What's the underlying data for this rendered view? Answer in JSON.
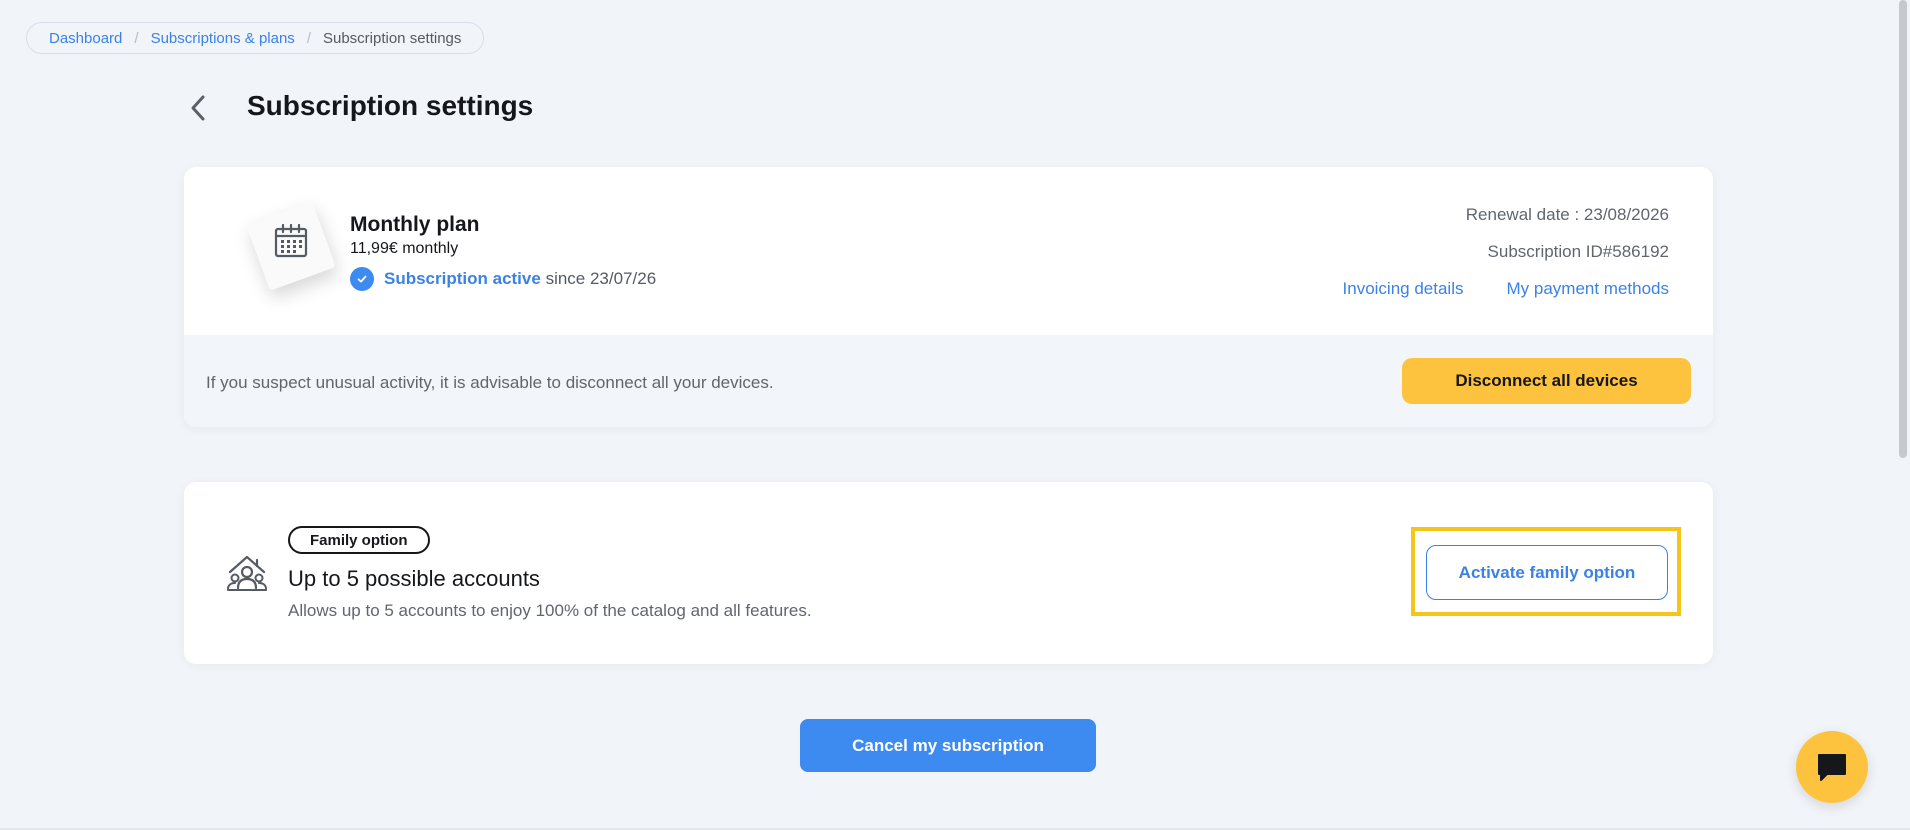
{
  "breadcrumb": {
    "items": [
      "Dashboard",
      "Subscriptions & plans"
    ],
    "current": "Subscription settings"
  },
  "page": {
    "title": "Subscription settings"
  },
  "plan": {
    "name": "Monthly plan",
    "price": "11,99€ monthly",
    "status_label": "Subscription active",
    "status_since": "since 23/07/26",
    "renewal": "Renewal date : 23/08/2026",
    "subscription_id": "Subscription ID#586192",
    "invoicing_link": "Invoicing details",
    "payment_link": "My payment methods",
    "warning_text": "If you suspect unusual activity, it is advisable to disconnect all your devices.",
    "disconnect_label": "Disconnect all devices",
    "icon": "calendar-icon"
  },
  "family": {
    "badge": "Family option",
    "title": "Up to 5 possible accounts",
    "description": "Allows up to 5 accounts to enjoy 100% of the catalog and all features.",
    "activate_label": "Activate family option",
    "icon": "family-house-icon"
  },
  "actions": {
    "cancel_label": "Cancel my subscription"
  },
  "chat": {
    "icon": "chat-bubble-icon"
  },
  "colors": {
    "accent_blue": "#3b82e6",
    "accent_yellow": "#fdc33e",
    "highlight": "#f4c51a",
    "background": "#f1f4f8"
  }
}
